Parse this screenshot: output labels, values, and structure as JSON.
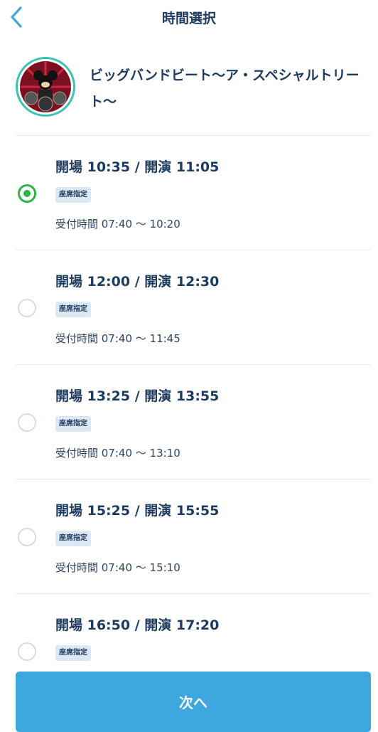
{
  "header": {
    "title": "時間選択",
    "back_icon": "chevron-left-icon"
  },
  "show": {
    "title": "ビッグバンドビート〜ア・スペシャルトリート〜"
  },
  "colors": {
    "accent": "#3ea7de",
    "selected": "#2db544",
    "text": "#1d3a5f"
  },
  "slots": [
    {
      "time": "開場 10:35 / 開演 11:05",
      "badge": "座席指定",
      "reception": "受付時間 07:40 〜 10:20",
      "selected": true
    },
    {
      "time": "開場 12:00 / 開演 12:30",
      "badge": "座席指定",
      "reception": "受付時間 07:40 〜 11:45",
      "selected": false
    },
    {
      "time": "開場 13:25 / 開演 13:55",
      "badge": "座席指定",
      "reception": "受付時間 07:40 〜 13:10",
      "selected": false
    },
    {
      "time": "開場 15:25 / 開演 15:55",
      "badge": "座席指定",
      "reception": "受付時間 07:40 〜 15:10",
      "selected": false
    },
    {
      "time": "開場 16:50 / 開演 17:20",
      "badge": "座席指定",
      "reception": "",
      "selected": false
    }
  ],
  "footer": {
    "next_label": "次へ"
  }
}
